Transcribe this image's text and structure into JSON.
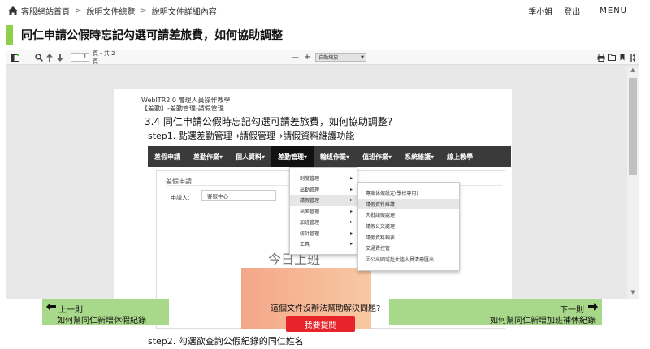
{
  "topbar": {
    "breadcrumbs": [
      "客服網站首頁",
      "說明文件總覽",
      "說明文件詳細內容"
    ],
    "separator": ">",
    "user_name": "季小姐",
    "logout": "登出",
    "menu": "MENU"
  },
  "page": {
    "title": "同仁申請公假時忘記勾選可請差旅費，如何協助調整"
  },
  "viewer": {
    "current_page": "1",
    "page_count": "頁 - 共 2 頁",
    "zoom_minus": "—",
    "zoom_plus": "+",
    "zoom_value": "自動縮放"
  },
  "doc": {
    "header1": "WebITR2.0 管理人員操作教學",
    "header2": "【差勤】-差勤管理-請假管理",
    "heading": "3.4  同仁申請公假時忘記勾選可請差旅費，如何協助調整?",
    "step1": "step1.   點選差勤管理→請假管理→請假資料維護功能",
    "step2": "step2.   勾選欲查詢公假紀錄的同仁姓名",
    "shot": {
      "nav": [
        "差假申請",
        "差勤作業▾",
        "個人資料▾",
        "差勤管理▾",
        "輪班作業▾",
        "值班作業▾",
        "系統維護▾",
        "線上教學"
      ],
      "active_nav_index": 3,
      "section_title": "差假申請",
      "applicant_label": "申請人：",
      "applicant_value": "客服中心",
      "today_text": "今日上班",
      "menu1": [
        {
          "label": "制度管理",
          "arrow": "▸"
        },
        {
          "label": "出勤管理",
          "arrow": "▸"
        },
        {
          "label": "請假管理",
          "arrow": "▸"
        },
        {
          "label": "出差管理",
          "arrow": "▸"
        },
        {
          "label": "加班管理",
          "arrow": "▸"
        },
        {
          "label": "統計管理",
          "arrow": "▸"
        },
        {
          "label": "工具",
          "arrow": "▸"
        }
      ],
      "menu2": [
        "專案休假設定(學校專用)",
        "請假資料維護",
        "大批請假處理",
        "請假公文處理",
        "請假資料報表",
        "交通費控管",
        "因公出國或赴大陸人員清冊匯出"
      ]
    }
  },
  "bottom": {
    "prev_label": "上一則",
    "prev_title": "如何幫同仁新增休假紀錄",
    "next_label": "下一則",
    "next_title": "如何幫同仁新增加班補休紀錄",
    "question": "這個文件沒辦法幫助解決問題?",
    "ask_button": "我要提問"
  },
  "colors": {
    "accent_green": "#8fd04a",
    "nav_box_green": "#a8d889",
    "ask_red": "#e8242a",
    "shot_nav_dark": "#3a3a3a"
  }
}
